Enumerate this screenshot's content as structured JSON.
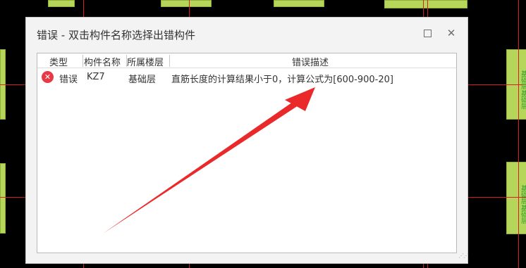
{
  "dialog": {
    "title": "错误 - 双击构件名称选择出错构件",
    "maximize_label": "",
    "close_label": "✕"
  },
  "table": {
    "headers": [
      "类型",
      "构件名称",
      "所属楼层",
      "错误描述"
    ],
    "rows": [
      {
        "type": "错误",
        "name": "KZ7",
        "floor": "基础层",
        "description": "直筋长度的计算结果小于0，计算公式为[600-900-20]"
      }
    ]
  },
  "cad_labels": [
    "基础层",
    "基础层",
    "基础层",
    "基础层"
  ],
  "colors": {
    "background": "#000000",
    "column_fill": "#b5d65a",
    "grid_line": "#d42020",
    "dialog_bg": "#f3f3f3",
    "error_icon": "#e63a46",
    "annotation_arrow": "#ea2a2a"
  },
  "icons": [
    "error-icon",
    "maximize-icon",
    "close-icon",
    "resize-grip-icon"
  ]
}
